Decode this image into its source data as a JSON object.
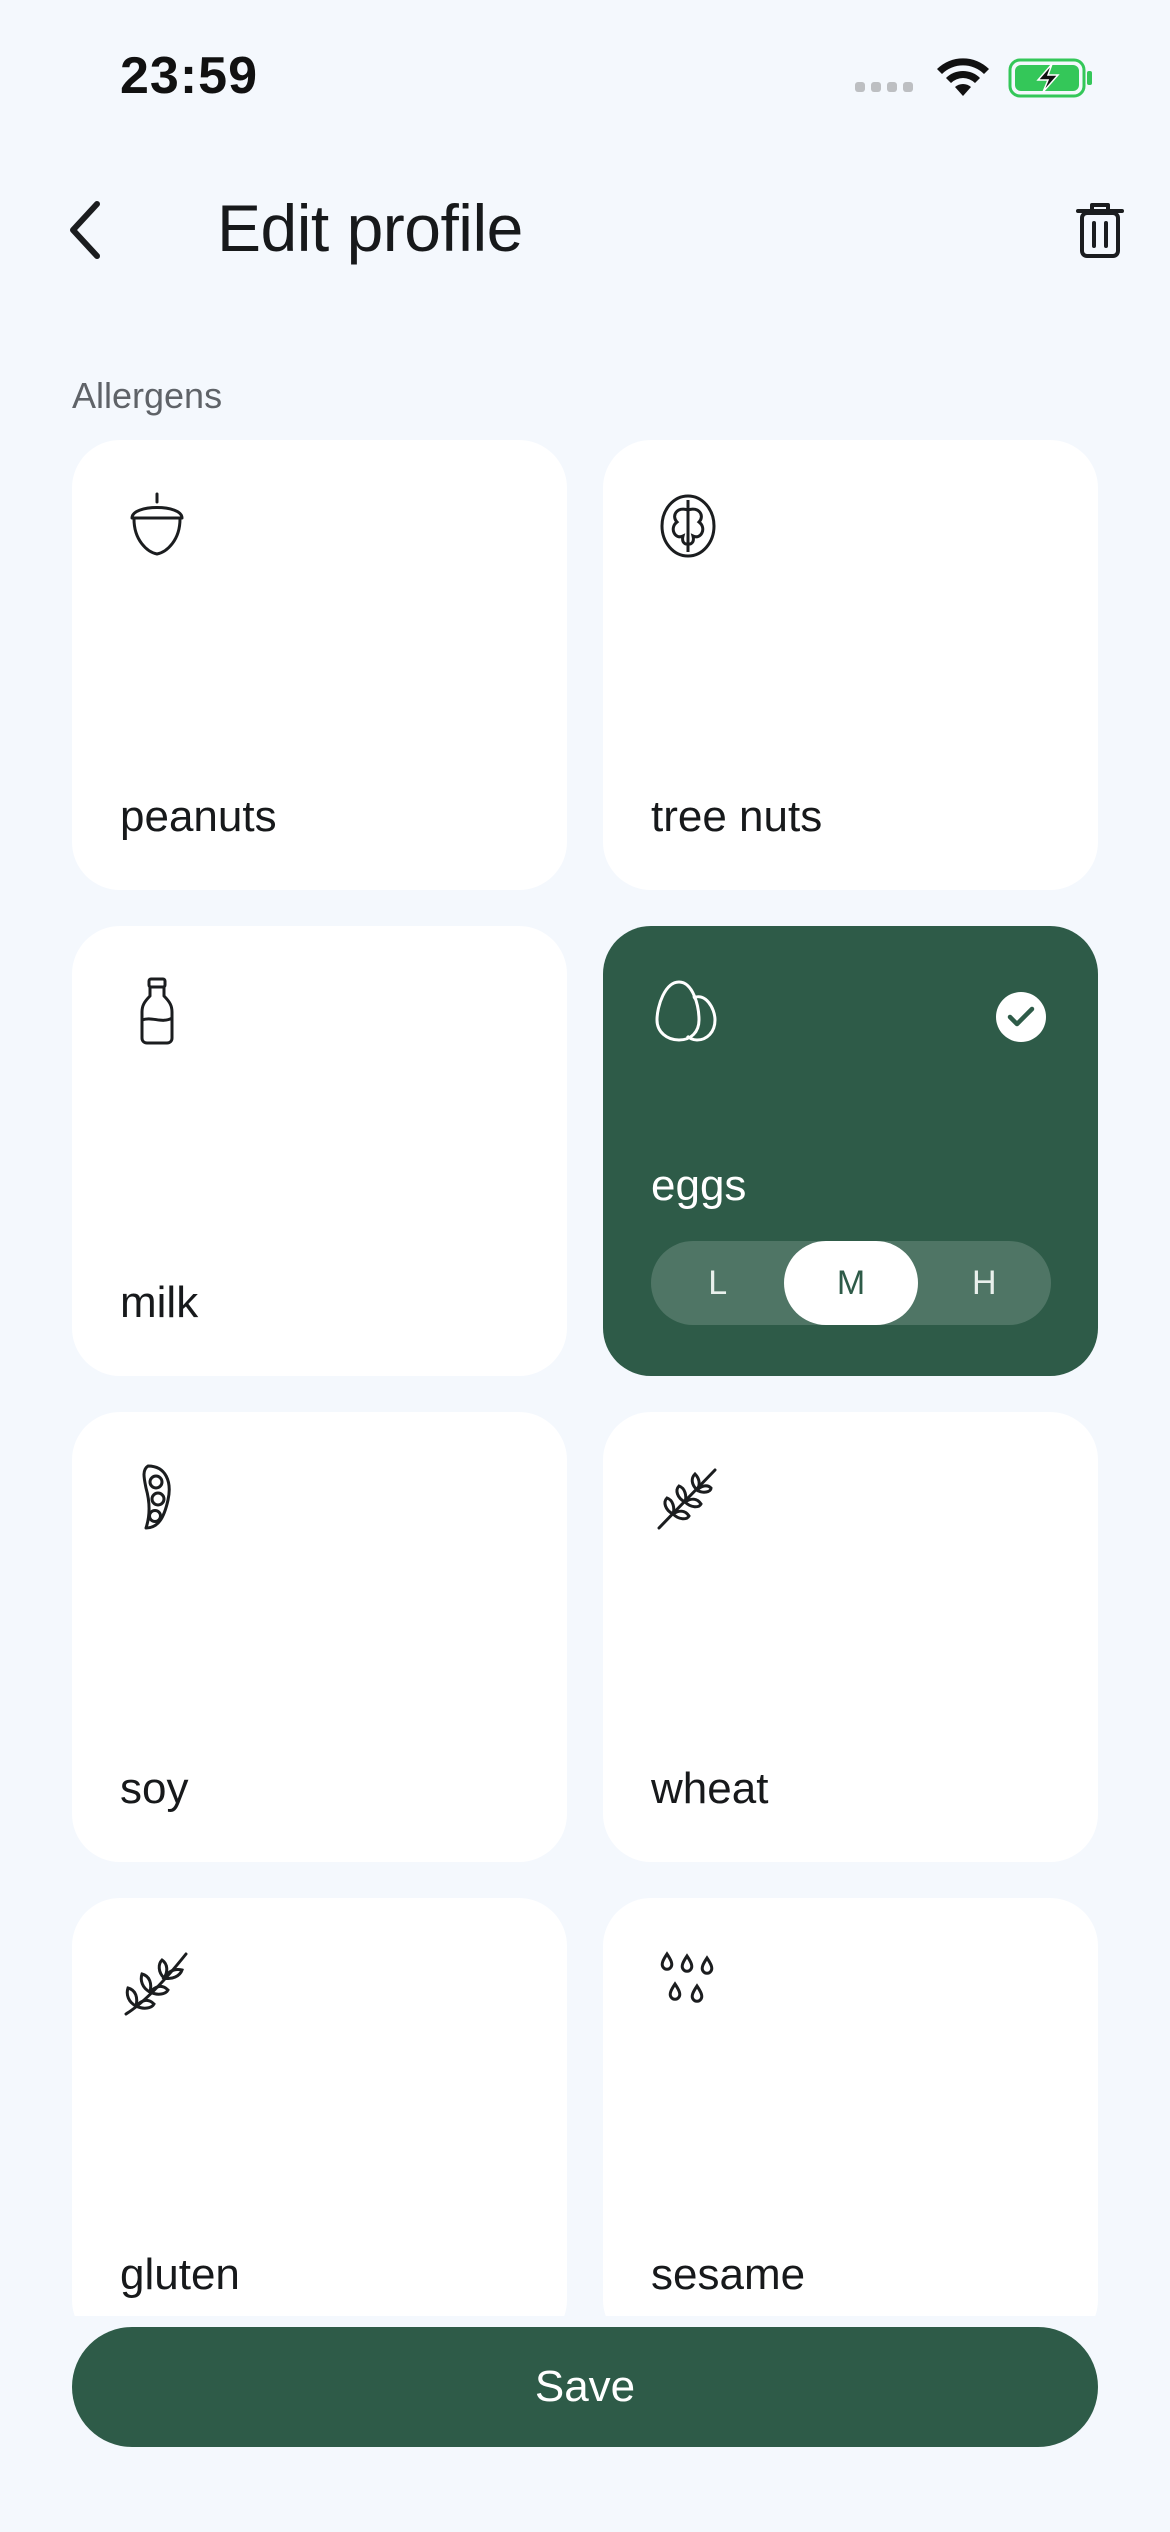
{
  "status_bar": {
    "time": "23:59"
  },
  "header": {
    "title": "Edit profile"
  },
  "section": {
    "label": "Allergens"
  },
  "allergens": [
    {
      "label": "peanuts",
      "icon": "acorn-icon",
      "selected": false
    },
    {
      "label": "tree nuts",
      "icon": "walnut-icon",
      "selected": false
    },
    {
      "label": "milk",
      "icon": "milk-bottle-icon",
      "selected": false
    },
    {
      "label": "eggs",
      "icon": "eggs-icon",
      "selected": true,
      "levels": [
        "L",
        "M",
        "H"
      ],
      "active_level": "M"
    },
    {
      "label": "soy",
      "icon": "soybean-pod-icon",
      "selected": false
    },
    {
      "label": "wheat",
      "icon": "wheat-icon",
      "selected": false
    },
    {
      "label": "gluten",
      "icon": "grain-icon",
      "selected": false
    },
    {
      "label": "sesame",
      "icon": "sesame-seeds-icon",
      "selected": false
    }
  ],
  "actions": {
    "save_label": "Save"
  },
  "colors": {
    "accent": "#2E5B48",
    "background": "#F4F8FD",
    "card": "#FFFFFF",
    "battery": "#34C759"
  }
}
